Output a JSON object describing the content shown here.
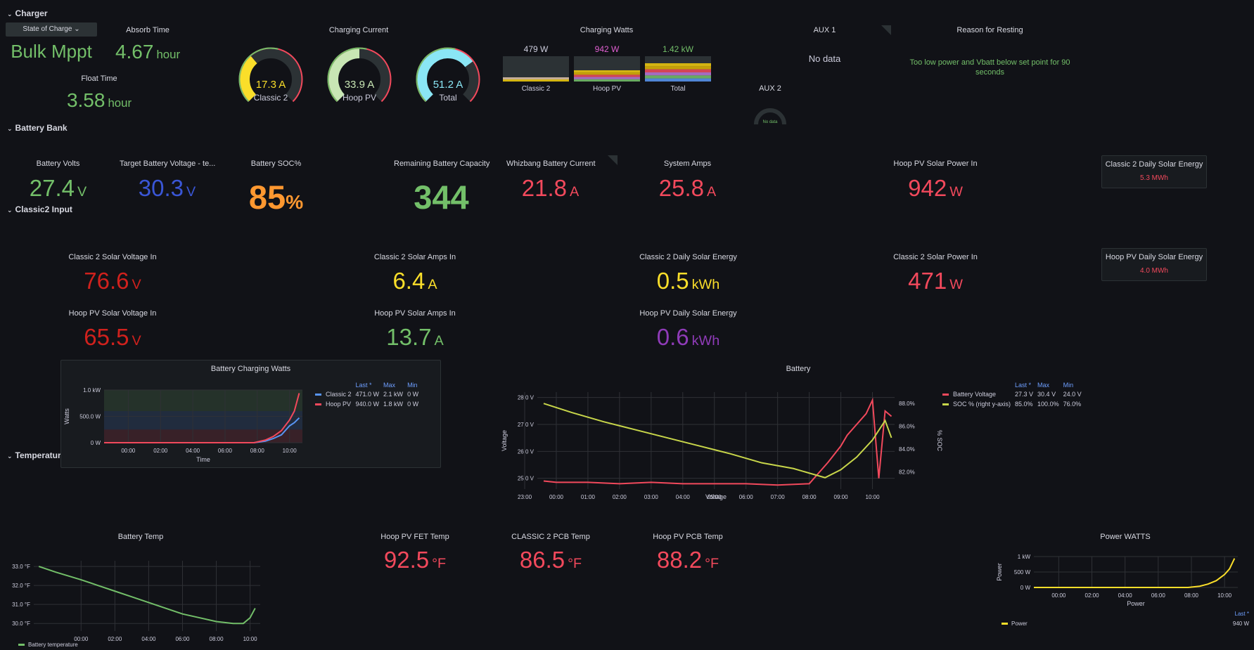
{
  "rows": {
    "charger": "Charger",
    "battery_bank": "Battery Bank",
    "classic2_input": "Classic2 Input",
    "temperatures": "Temperatures"
  },
  "charger": {
    "state_dropdown": "State of Charge",
    "state_value": "Bulk Mppt",
    "absorb_title": "Absorb Time",
    "absorb_value": "4.67",
    "absorb_unit": "hour",
    "float_title": "Float Time",
    "float_value": "3.58",
    "float_unit": "hour",
    "current_title": "Charging Current",
    "gauges": [
      {
        "value": "17.3 A",
        "label": "Classic 2",
        "color": "#fade2a",
        "fraction": 0.35
      },
      {
        "value": "33.9 A",
        "label": "Hoop PV",
        "color": "#c8e6b4",
        "fraction": 0.5
      },
      {
        "value": "51.2 A",
        "label": "Total",
        "color": "#8ae6f5",
        "fraction": 0.7
      }
    ],
    "watts_title": "Charging Watts",
    "watts": [
      {
        "value": "479 W",
        "label": "Classic 2",
        "color": "#ccccdc"
      },
      {
        "value": "942 W",
        "label": "Hoop PV",
        "color": "#e05fd1"
      },
      {
        "value": "1.42 kW",
        "label": "Total",
        "color": "#73bf69"
      }
    ],
    "aux1_title": "AUX 1",
    "aux1_value": "No data",
    "aux2_title": "AUX 2",
    "aux2_value": "No data",
    "reason_title": "Reason for Resting",
    "reason_value": "Too low power and Vbatt below set point for 90 seconds"
  },
  "battery_bank": {
    "volts_title": "Battery Volts",
    "volts_value": "27.4",
    "volts_unit": "V",
    "target_title": "Target Battery Voltage - te...",
    "target_value": "30.3",
    "target_unit": "V",
    "soc_title": "Battery SOC%",
    "soc_value": "85",
    "soc_unit": "%",
    "capacity_title": "Remaining Battery Capacity",
    "capacity_value": "344",
    "whiz_title": "Whizbang Battery Current",
    "whiz_value": "21.8",
    "whiz_unit": "A",
    "sys_title": "System Amps",
    "sys_value": "25.8",
    "sys_unit": "A",
    "hoop_power_title": "Hoop PV Solar Power In",
    "hoop_power_value": "942",
    "hoop_power_unit": "W",
    "c2_daily_title": "Classic 2 Daily Solar Energy",
    "c2_daily_value": "5.3 MWh"
  },
  "classic2_input": {
    "c2_volt_title": "Classic 2 Solar Voltage In",
    "c2_volt_value": "76.6",
    "c2_volt_unit": "V",
    "c2_amps_title": "Classic 2 Solar Amps In",
    "c2_amps_value": "6.4",
    "c2_amps_unit": "A",
    "c2_energy_title": "Classic 2 Daily Solar Energy",
    "c2_energy_value": "0.5",
    "c2_energy_unit": "kWh",
    "c2_power_title": "Classic 2 Solar Power In",
    "c2_power_value": "471",
    "c2_power_unit": "W",
    "hoop_daily_title": "Hoop PV Daily Solar Energy",
    "hoop_daily_value": "4.0 MWh",
    "hoop_volt_title": "Hoop PV Solar Voltage In",
    "hoop_volt_value": "65.5",
    "hoop_volt_unit": "V",
    "hoop_amps_title": "Hoop PV Solar Amps In",
    "hoop_amps_value": "13.7",
    "hoop_amps_unit": "A",
    "hoop_energy_title": "Hoop PV Daily Solar Energy",
    "hoop_energy_value": "0.6",
    "hoop_energy_unit": "kWh"
  },
  "temperatures": {
    "battery_temp_title": "Battery Temp",
    "fet_title": "Hoop PV FET Temp",
    "fet_value": "92.5",
    "fet_unit": "°F",
    "c2pcb_title": "CLASSIC 2 PCB Temp",
    "c2pcb_value": "86.5",
    "c2pcb_unit": "°F",
    "hooppcb_title": "Hoop PV PCB Temp",
    "hooppcb_value": "88.2",
    "hooppcb_unit": "°F",
    "power_title": "Power WATTS"
  },
  "chart_data": [
    {
      "type": "line",
      "title": "Battery Charging Watts",
      "xlabel": "Time",
      "ylabel": "Watts",
      "x_ticks": [
        "00:00",
        "02:00",
        "04:00",
        "06:00",
        "08:00",
        "10:00"
      ],
      "y_ticks": [
        "0 W",
        "500.0 W",
        "1.0 kW"
      ],
      "ylim": [
        0,
        1000
      ],
      "legend_headers": [
        "Last *",
        "Max",
        "Min"
      ],
      "series": [
        {
          "name": "Classic 2",
          "color": "#5794f2",
          "last": "471.0 W",
          "max": "2.1 kW",
          "min": "0 W",
          "x": [
            -1.5,
            0,
            2,
            4,
            6,
            7.8,
            8.5,
            9,
            9.5,
            10,
            10.3,
            10.6
          ],
          "values": [
            0,
            0,
            0,
            0,
            0,
            0,
            30,
            80,
            150,
            320,
            380,
            471
          ]
        },
        {
          "name": "Hoop PV",
          "color": "#f2495c",
          "last": "940.0 W",
          "max": "1.8 kW",
          "min": "0 W",
          "x": [
            -1.5,
            0,
            2,
            4,
            6,
            7.8,
            8.5,
            9,
            9.5,
            10,
            10.3,
            10.6
          ],
          "values": [
            0,
            0,
            0,
            0,
            0,
            0,
            50,
            120,
            230,
            430,
            600,
            940
          ]
        }
      ]
    },
    {
      "type": "line",
      "title": "Battery",
      "xlabel": "Voltage",
      "ylabel": "Voltage",
      "y2label": "% SOC",
      "x_ticks": [
        "23:00",
        "00:00",
        "01:00",
        "02:00",
        "03:00",
        "04:00",
        "05:00",
        "06:00",
        "07:00",
        "08:00",
        "09:00",
        "10:00"
      ],
      "y_ticks": [
        "25.0 V",
        "26.0 V",
        "27.0 V",
        "28.0 V"
      ],
      "y2_ticks": [
        "82.0%",
        "84.0%",
        "86.0%",
        "88.0%"
      ],
      "ylim": [
        24.6,
        28.2
      ],
      "y2lim": [
        80.5,
        89
      ],
      "legend_headers": [
        "Last *",
        "Max",
        "Min"
      ],
      "series": [
        {
          "name": "Battery Voltage",
          "color": "#f2495c",
          "axis": "left",
          "last": "27.3 V",
          "max": "30.4 V",
          "min": "24.0 V",
          "x": [
            -0.4,
            0,
            1,
            2,
            3,
            4,
            5,
            6,
            7,
            8,
            8.3,
            8.6,
            9,
            9.2,
            9.5,
            9.8,
            10,
            10.2,
            10.4,
            10.6
          ],
          "values": [
            24.9,
            24.85,
            24.85,
            24.8,
            24.85,
            24.8,
            24.8,
            24.8,
            24.75,
            24.8,
            25.2,
            25.6,
            26.2,
            26.6,
            27.0,
            27.4,
            27.9,
            25.0,
            27.5,
            27.3
          ]
        },
        {
          "name": "SOC % (right y-axis)",
          "secondary_label": "(right y-axis)",
          "color": "#c8d64a",
          "axis": "right",
          "last": "85.0%",
          "max": "100.0%",
          "min": "76.0%",
          "x": [
            -0.4,
            0.5,
            1.5,
            2.5,
            3.5,
            4.5,
            5.5,
            6.5,
            7.5,
            8.5,
            9.0,
            9.5,
            10.0,
            10.4,
            10.6
          ],
          "values": [
            88,
            87.2,
            86.4,
            85.7,
            85.0,
            84.3,
            83.6,
            82.8,
            82.3,
            81.5,
            82.2,
            83.3,
            84.8,
            86.5,
            85.0
          ]
        }
      ]
    },
    {
      "type": "line",
      "title": "Battery Temp",
      "x_ticks": [
        "00:00",
        "02:00",
        "04:00",
        "06:00",
        "08:00",
        "10:00"
      ],
      "y_ticks": [
        "30.0 °F",
        "31.0 °F",
        "32.0 °F",
        "33.0 °F"
      ],
      "ylim": [
        29.6,
        33.3
      ],
      "series": [
        {
          "name": "Battery temperature",
          "color": "#73bf69",
          "x": [
            -2.5,
            -1.5,
            0,
            1,
            2,
            3,
            4,
            5,
            6,
            7,
            8,
            9,
            9.6,
            10,
            10.3
          ],
          "values": [
            33.0,
            32.7,
            32.3,
            32.0,
            31.7,
            31.4,
            31.1,
            30.8,
            30.5,
            30.3,
            30.1,
            30.0,
            30.0,
            30.3,
            30.8
          ]
        }
      ]
    },
    {
      "type": "line",
      "title": "Power WATTS",
      "xlabel": "Power",
      "ylabel": "Power",
      "x_ticks": [
        "00:00",
        "02:00",
        "04:00",
        "06:00",
        "08:00",
        "10:00"
      ],
      "y_ticks": [
        "0 W",
        "500 W",
        "1 kW"
      ],
      "ylim": [
        0,
        1000
      ],
      "legend_headers": [
        "Last *"
      ],
      "series": [
        {
          "name": "Power",
          "color": "#fade2a",
          "last": "940 W",
          "x": [
            -1.5,
            0,
            2,
            4,
            6,
            7.8,
            8.5,
            9,
            9.5,
            10,
            10.3,
            10.6
          ],
          "values": [
            0,
            0,
            0,
            0,
            0,
            0,
            40,
            110,
            220,
            420,
            600,
            940
          ]
        }
      ]
    }
  ]
}
